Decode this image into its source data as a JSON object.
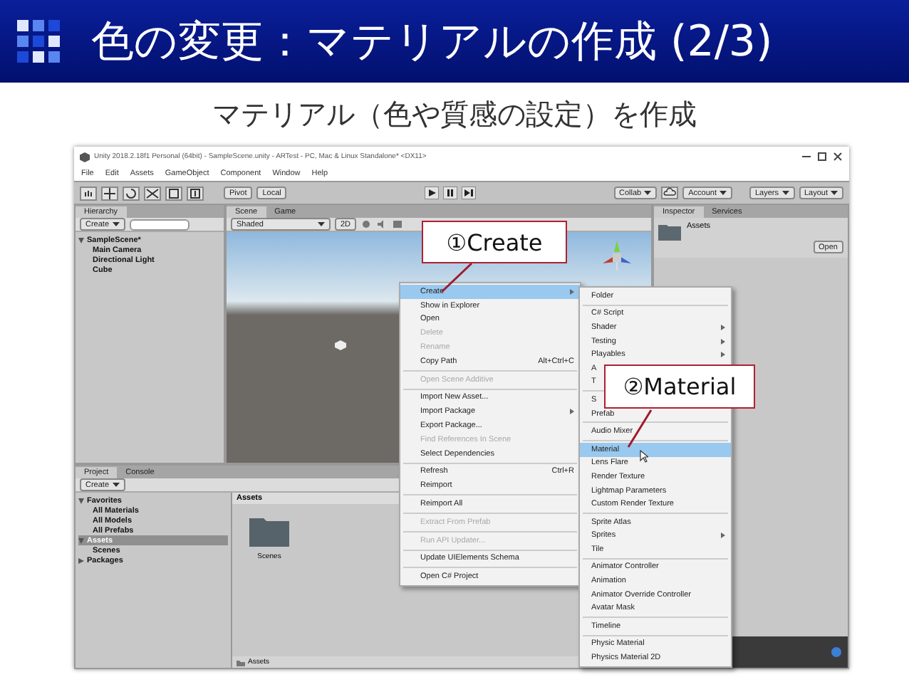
{
  "slide": {
    "title": "色の変更：マテリアルの作成 (2/3)",
    "subtitle": "マテリアル（色や質感の設定）を作成"
  },
  "window": {
    "title": "Unity 2018.2.18f1 Personal (64bit) - SampleScene.unity - ARTest - PC, Mac & Linux Standalone* <DX11>"
  },
  "menu_bar": [
    "File",
    "Edit",
    "Assets",
    "GameObject",
    "Component",
    "Window",
    "Help"
  ],
  "toolbar": {
    "pivot": "Pivot",
    "local": "Local",
    "collab": "Collab",
    "account": "Account",
    "layers": "Layers",
    "layout": "Layout"
  },
  "hierarchy": {
    "tab": "Hierarchy",
    "create": "Create",
    "tree": [
      {
        "label": "SampleScene*",
        "expanded": true,
        "selected": false,
        "children": [
          {
            "label": "Main Camera",
            "selected": false
          },
          {
            "label": "Directional Light",
            "selected": false
          },
          {
            "label": "Cube",
            "selected": false
          }
        ]
      }
    ]
  },
  "scene": {
    "tabs": [
      {
        "label": "Scene",
        "selected": true
      },
      {
        "label": "Game",
        "selected": false
      }
    ],
    "shading": "Shaded",
    "mode": "2D"
  },
  "inspector": {
    "tabs": [
      {
        "label": "Inspector",
        "selected": true
      },
      {
        "label": "Services",
        "selected": false
      }
    ],
    "asset": "Assets",
    "open_button": "Open"
  },
  "project": {
    "tabs": [
      {
        "label": "Project",
        "selected": true
      },
      {
        "label": "Console",
        "selected": false
      }
    ],
    "create": "Create",
    "tree": [
      {
        "label": "Favorites",
        "expanded": true,
        "selected": false,
        "children": [
          {
            "label": "All Materials",
            "selected": false
          },
          {
            "label": "All Models",
            "selected": false
          },
          {
            "label": "All Prefabs",
            "selected": false
          }
        ]
      },
      {
        "label": "Assets",
        "expanded": true,
        "selected": true,
        "children": [
          {
            "label": "Scenes",
            "selected": false
          }
        ]
      },
      {
        "label": "Packages",
        "expanded": false,
        "selected": false
      }
    ],
    "breadcrumb": "Assets",
    "items": [
      {
        "label": "Scenes"
      }
    ],
    "footer": "Assets"
  },
  "context_menu": [
    {
      "kind": "item",
      "label": "Create",
      "selected": true,
      "disabled": false,
      "submenu": true
    },
    {
      "kind": "item",
      "label": "Show in Explorer",
      "selected": false,
      "disabled": false,
      "submenu": false
    },
    {
      "kind": "item",
      "label": "Open",
      "selected": false,
      "disabled": false,
      "submenu": false
    },
    {
      "kind": "item",
      "label": "Delete",
      "selected": false,
      "disabled": true,
      "submenu": false
    },
    {
      "kind": "item",
      "label": "Rename",
      "selected": false,
      "disabled": true,
      "submenu": false
    },
    {
      "kind": "item",
      "label": "Copy Path",
      "shortcut": "Alt+Ctrl+C",
      "selected": false,
      "disabled": false,
      "submenu": false
    },
    {
      "kind": "separator"
    },
    {
      "kind": "item",
      "label": "Open Scene Additive",
      "selected": false,
      "disabled": true,
      "submenu": false
    },
    {
      "kind": "separator"
    },
    {
      "kind": "item",
      "label": "Import New Asset...",
      "selected": false,
      "disabled": false,
      "submenu": false
    },
    {
      "kind": "item",
      "label": "Import Package",
      "selected": false,
      "disabled": false,
      "submenu": true
    },
    {
      "kind": "item",
      "label": "Export Package...",
      "selected": false,
      "disabled": false,
      "submenu": false
    },
    {
      "kind": "item",
      "label": "Find References In Scene",
      "selected": false,
      "disabled": true,
      "submenu": false
    },
    {
      "kind": "item",
      "label": "Select Dependencies",
      "selected": false,
      "disabled": false,
      "submenu": false
    },
    {
      "kind": "separator"
    },
    {
      "kind": "item",
      "label": "Refresh",
      "shortcut": "Ctrl+R",
      "selected": false,
      "disabled": false,
      "submenu": false
    },
    {
      "kind": "item",
      "label": "Reimport",
      "selected": false,
      "disabled": false,
      "submenu": false
    },
    {
      "kind": "separator"
    },
    {
      "kind": "item",
      "label": "Reimport All",
      "selected": false,
      "disabled": false,
      "submenu": false
    },
    {
      "kind": "separator"
    },
    {
      "kind": "item",
      "label": "Extract From Prefab",
      "selected": false,
      "disabled": true,
      "submenu": false
    },
    {
      "kind": "separator"
    },
    {
      "kind": "item",
      "label": "Run API Updater...",
      "selected": false,
      "disabled": true,
      "submenu": false
    },
    {
      "kind": "separator"
    },
    {
      "kind": "item",
      "label": "Update UIElements Schema",
      "selected": false,
      "disabled": false,
      "submenu": false
    },
    {
      "kind": "separator"
    },
    {
      "kind": "item",
      "label": "Open C# Project",
      "selected": false,
      "disabled": false,
      "submenu": false
    }
  ],
  "create_submenu": [
    {
      "kind": "item",
      "label": "Folder",
      "selected": false,
      "disabled": false,
      "submenu": false
    },
    {
      "kind": "separator"
    },
    {
      "kind": "item",
      "label": "C# Script",
      "selected": false,
      "disabled": false,
      "submenu": false
    },
    {
      "kind": "item",
      "label": "Shader",
      "selected": false,
      "disabled": false,
      "submenu": true
    },
    {
      "kind": "item",
      "label": "Testing",
      "selected": false,
      "disabled": false,
      "submenu": true
    },
    {
      "kind": "item",
      "label": "Playables",
      "selected": false,
      "disabled": false,
      "submenu": true
    },
    {
      "kind": "item",
      "label": "A",
      "selected": false,
      "disabled": false
    },
    {
      "kind": "item",
      "label": "T",
      "selected": false,
      "disabled": false
    },
    {
      "kind": "separator"
    },
    {
      "kind": "item",
      "label": "S",
      "selected": false,
      "disabled": false
    },
    {
      "kind": "item",
      "label": "Prefab",
      "selected": false,
      "disabled": false,
      "submenu": false
    },
    {
      "kind": "separator"
    },
    {
      "kind": "item",
      "label": "Audio Mixer",
      "selected": false,
      "disabled": false,
      "submenu": false
    },
    {
      "kind": "separator"
    },
    {
      "kind": "item",
      "label": "Material",
      "selected": true,
      "disabled": false,
      "submenu": false
    },
    {
      "kind": "item",
      "label": "Lens Flare",
      "selected": false,
      "disabled": false,
      "submenu": false
    },
    {
      "kind": "item",
      "label": "Render Texture",
      "selected": false,
      "disabled": false,
      "submenu": false
    },
    {
      "kind": "item",
      "label": "Lightmap Parameters",
      "selected": false,
      "disabled": false,
      "submenu": false
    },
    {
      "kind": "item",
      "label": "Custom Render Texture",
      "selected": false,
      "disabled": false,
      "submenu": false
    },
    {
      "kind": "separator"
    },
    {
      "kind": "item",
      "label": "Sprite Atlas",
      "selected": false,
      "disabled": false,
      "submenu": false
    },
    {
      "kind": "item",
      "label": "Sprites",
      "selected": false,
      "disabled": false,
      "submenu": true
    },
    {
      "kind": "item",
      "label": "Tile",
      "selected": false,
      "disabled": false,
      "submenu": false
    },
    {
      "kind": "separator"
    },
    {
      "kind": "item",
      "label": "Animator Controller",
      "selected": false,
      "disabled": false,
      "submenu": false
    },
    {
      "kind": "item",
      "label": "Animation",
      "selected": false,
      "disabled": false,
      "submenu": false
    },
    {
      "kind": "item",
      "label": "Animator Override Controller",
      "selected": false,
      "disabled": false,
      "submenu": false
    },
    {
      "kind": "item",
      "label": "Avatar Mask",
      "selected": false,
      "disabled": false,
      "submenu": false
    },
    {
      "kind": "separator"
    },
    {
      "kind": "item",
      "label": "Timeline",
      "selected": false,
      "disabled": false,
      "submenu": false
    },
    {
      "kind": "separator"
    },
    {
      "kind": "item",
      "label": "Physic Material",
      "selected": false,
      "disabled": false,
      "submenu": false
    },
    {
      "kind": "item",
      "label": "Physics Material 2D",
      "selected": false,
      "disabled": false,
      "submenu": false
    }
  ],
  "callouts": [
    {
      "label": "①Create"
    },
    {
      "label": "②Material"
    }
  ]
}
